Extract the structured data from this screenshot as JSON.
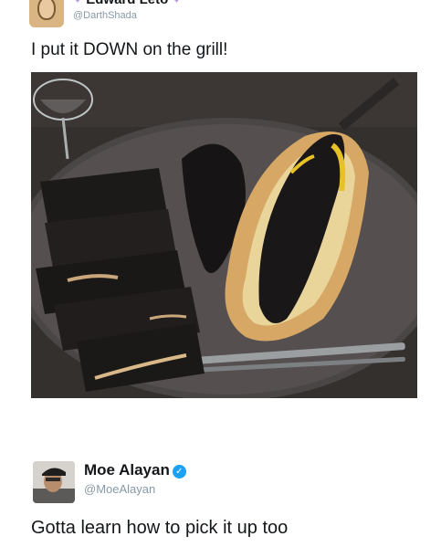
{
  "tweet1": {
    "name": "Edward Leto",
    "sparkle_left": "✦",
    "sparkle_right": "✦",
    "handle": "@DarthShada",
    "text": "I put it DOWN on the grill!"
  },
  "tweet2": {
    "name": "Moe Alayan",
    "verified_icon": "✓",
    "handle": "@MoeAlayan",
    "text": "Gotta learn how to pick it up too"
  },
  "colors": {
    "handle": "#8899a6",
    "text": "#14171a",
    "verified": "#1da1f2"
  }
}
